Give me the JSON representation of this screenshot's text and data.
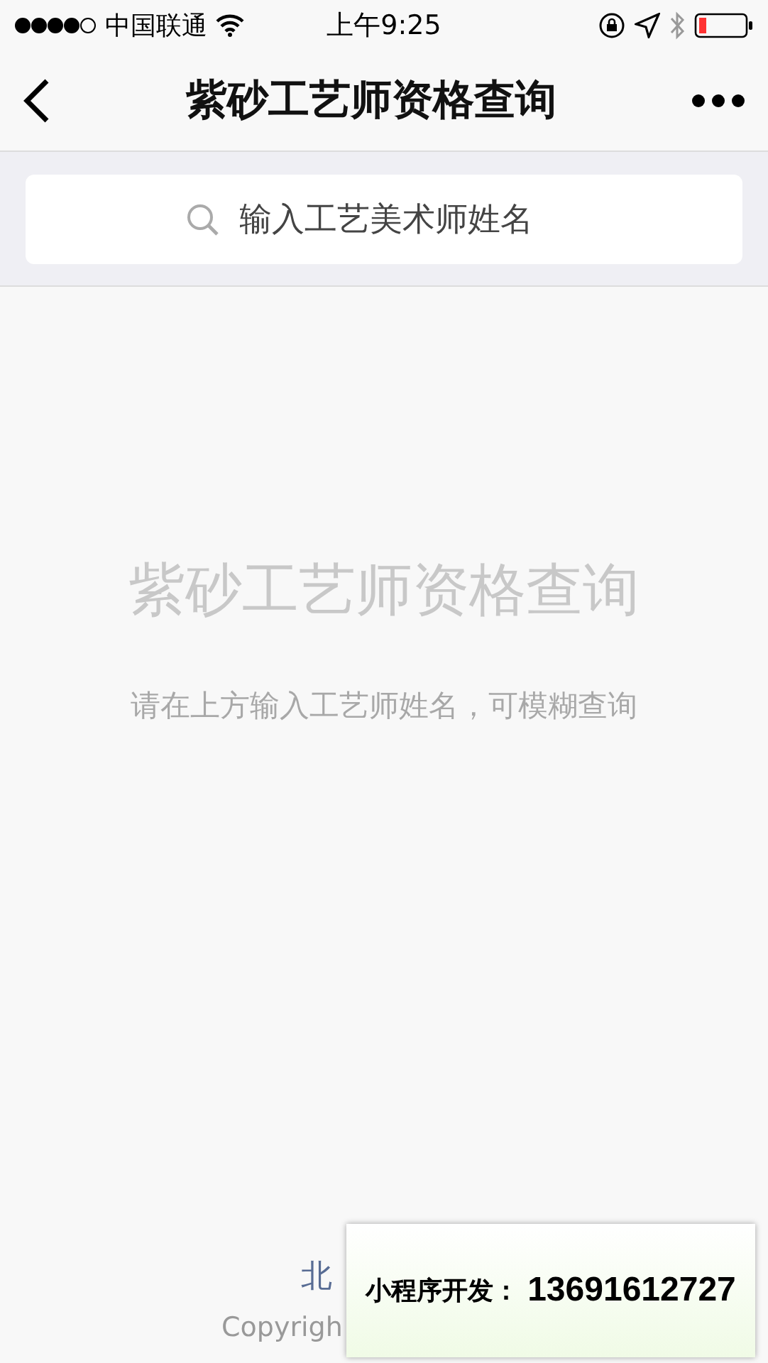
{
  "status_bar": {
    "carrier": "中国联通",
    "time": "上午9:25"
  },
  "nav_bar": {
    "title": "紫砂工艺师资格查询"
  },
  "search": {
    "placeholder": "输入工艺美术师姓名"
  },
  "empty_state": {
    "title": "紫砂工艺师资格查询",
    "hint": "请在上方输入工艺师姓名，可模糊查询"
  },
  "footer": {
    "link": "北",
    "copyright": "Copyrigh"
  },
  "overlay": {
    "label": "小程序开发：",
    "phone": "13691612727"
  }
}
